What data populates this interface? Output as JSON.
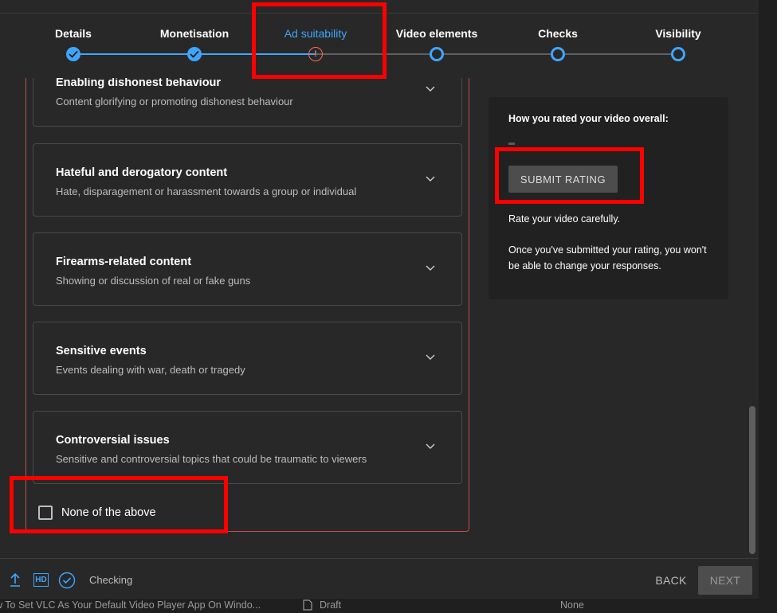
{
  "stepper": {
    "steps": [
      {
        "label": "Details",
        "state": "done"
      },
      {
        "label": "Monetisation",
        "state": "done"
      },
      {
        "label": "Ad suitability",
        "state": "warning",
        "marker": "!"
      },
      {
        "label": "Video elements",
        "state": "pending"
      },
      {
        "label": "Checks",
        "state": "pending"
      },
      {
        "label": "Visibility",
        "state": "pending"
      }
    ]
  },
  "categories": [
    {
      "title": "Enabling dishonest behaviour",
      "subtitle": "Content glorifying or promoting dishonest behaviour"
    },
    {
      "title": "Hateful and derogatory content",
      "subtitle": "Hate, disparagement or harassment towards a group or individual"
    },
    {
      "title": "Firearms-related content",
      "subtitle": "Showing or discussion of real or fake guns"
    },
    {
      "title": "Sensitive events",
      "subtitle": "Events dealing with war, death or tragedy"
    },
    {
      "title": "Controversial issues",
      "subtitle": "Sensitive and controversial topics that could be traumatic to viewers"
    }
  ],
  "none_option": {
    "label": "None of the above",
    "checked": false
  },
  "rating_panel": {
    "heading": "How you rated your video overall:",
    "submit_label": "SUBMIT RATING",
    "note1": "Rate your video carefully.",
    "note2": "Once you've submitted your rating, you won't be able to change your responses."
  },
  "footer": {
    "hd_label": "HD",
    "status": "Checking",
    "back_label": "BACK",
    "next_label": "NEXT"
  },
  "background_row": {
    "video_title": "w To Set VLC As Your Default Video Player App On Windo...",
    "visibility": "Draft",
    "restrictions": "None"
  },
  "colors": {
    "accent": "#3ea6ff",
    "warning": "#ff6b57",
    "highlight": "#ff0000",
    "panel_border": "#c74b4b"
  }
}
